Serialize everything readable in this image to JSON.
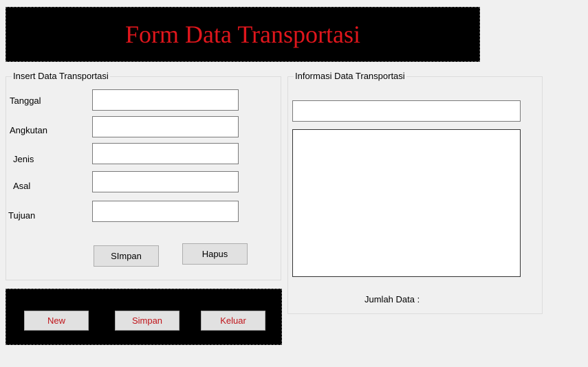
{
  "header": {
    "title": "Form Data Transportasi"
  },
  "insert_group": {
    "title": "Insert Data Transportasi",
    "fields": [
      {
        "label": "Tanggal",
        "value": ""
      },
      {
        "label": "Angkutan",
        "value": ""
      },
      {
        "label": "Jenis",
        "value": ""
      },
      {
        "label": "Asal",
        "value": ""
      },
      {
        "label": "Tujuan",
        "value": ""
      }
    ],
    "save_label": "SImpan",
    "delete_label": "Hapus"
  },
  "info_group": {
    "title": "Informasi Data Transportasi",
    "search_value": "",
    "count_label": "Jumlah Data :"
  },
  "bottom_panel": {
    "new_label": "New",
    "save_label": "Simpan",
    "exit_label": "Keluar"
  },
  "colors": {
    "banner_bg": "#000000",
    "title_red": "#e0161c",
    "button_text_red": "#c0141a"
  }
}
